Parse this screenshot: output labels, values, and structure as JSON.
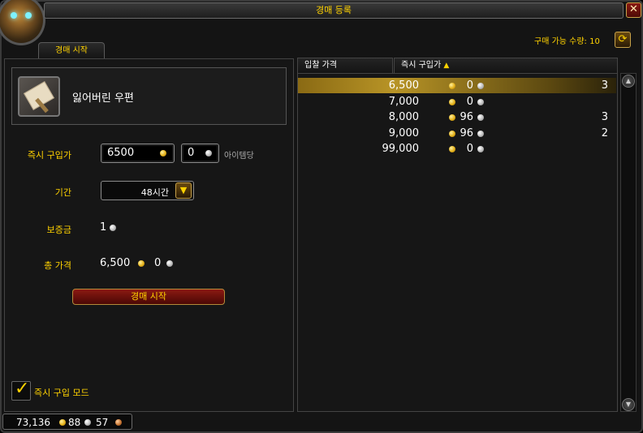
{
  "window": {
    "title": "경매 등록",
    "close_glyph": "✕"
  },
  "header": {
    "buy_quantity_label": "구매 가능 수량: 10",
    "refresh_glyph": "⟳"
  },
  "left": {
    "tab_label": "경매 시작",
    "item_name": "잃어버린 우편",
    "buyout_label": "즉시 구입가",
    "buyout_gold": "6500",
    "buyout_silver": "0",
    "per_item_label": "아이템당",
    "duration_label": "기간",
    "duration_value": "48시간",
    "deposit_label": "보증금",
    "deposit_value": "1",
    "total_label": "총 가격",
    "total_gold": "6,500",
    "total_silver": "0",
    "start_button": "경매 시작",
    "instant_buy_mode_label": "즉시 구입 모드"
  },
  "columns": {
    "bid": "입찰 가격",
    "buyout": "즉시 구입가",
    "sort_glyph": "▲"
  },
  "listings": [
    {
      "gold": "6,500",
      "silver": "0",
      "qty": "3"
    },
    {
      "gold": "7,000",
      "silver": "0",
      "qty": ""
    },
    {
      "gold": "8,000",
      "silver": "96",
      "qty": "3"
    },
    {
      "gold": "9,000",
      "silver": "96",
      "qty": "2"
    },
    {
      "gold": "99,000",
      "silver": "0",
      "qty": ""
    }
  ],
  "money": {
    "gold": "73,136",
    "silver": "88",
    "copper": "57"
  },
  "icons": {
    "close": "close-icon",
    "refresh": "refresh-icon",
    "dropdown": "chevron-down-icon",
    "checkbox": "checkmark-icon",
    "gold": "gold-coin-icon",
    "silver": "silver-coin-icon",
    "copper": "copper-coin-icon",
    "item": "letter-icon",
    "portrait": "player-portrait"
  },
  "colors": {
    "accent_gold": "#ffd200",
    "selected_row": "#b89426",
    "start_button": "#8c1a12"
  }
}
